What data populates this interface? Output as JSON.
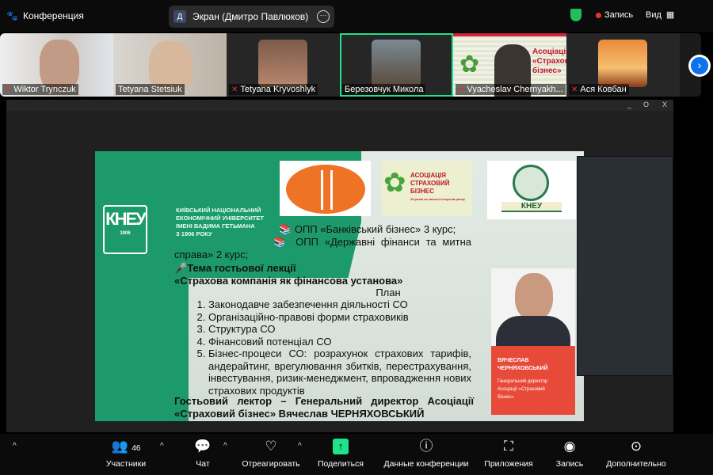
{
  "topbar": {
    "title": "Конференция",
    "screen_badge": "Д",
    "screen_label": "Экран (Дмитро Павлюков)",
    "record_label": "Запись",
    "view_label": "Вид"
  },
  "participants": [
    {
      "name": "Wiktor Trynczuk",
      "muted": true
    },
    {
      "name": "Tetyana Stetsiuk",
      "muted": false
    },
    {
      "name": "Tetyana Kryvoshlyk",
      "muted": true
    },
    {
      "name": "Березовчук Микола",
      "muted": false,
      "active": true
    },
    {
      "name": "Vyacheslav Chernyakh...",
      "muted": true
    },
    {
      "name": "Ася Ковбан",
      "muted": true
    }
  ],
  "tile_slogan": "Асоціація «Страховий бізнес»",
  "window_controls": {
    "min": "_",
    "max": "O",
    "close": "X"
  },
  "slide": {
    "university": [
      "КИЇВСЬКИЙ НАЦІОНАЛЬНИЙ",
      "ЕКОНОМІЧНИЙ УНІВЕРСИТЕТ",
      "ІМЕНІ ВАДИМА ГЕТЬМАНА",
      "З 1906 РОКУ"
    ],
    "kneu_logo": "КНЕУ",
    "kneu_year": "1906",
    "assoc_logo": [
      "АСОЦІАЦІЯ",
      "СТРАХОВИЙ БІЗНЕС",
      "20 років на захисті інтересів ринку"
    ],
    "kneu_emblem": "КНЕУ",
    "program1": "ОПП «Банківський бізнес» 3 курс;",
    "program2": "ОПП «Державні фінанси та митна справа» 2 курс;",
    "topic_label": "Тема гостьової лекції",
    "topic": "«Страхова компанія як фінансова установа»",
    "plan_title": "План",
    "plan": [
      "Законодавче забезпечення діяльності СО",
      "Організаційно-правові форми страховиків",
      "Структура СО",
      "Фінансовий потенціал СО",
      "Бізнес-процеси СО: розрахунок страхових тарифів, андерайтинг, врегулювання збитків, перестрахування, інвестування, ризик-менеджмент, впровадження нових страхових продуктів"
    ],
    "lecturer": "Гостьовий лектор – Генеральний директор Асоціації «Страховий бізнес» Вячеслав ЧЕРНЯХОВСЬКИЙ",
    "speaker_name": "ВЯЧЕСЛАВ ЧЕРНЯХОВСЬКИЙ",
    "speaker_title": "Генеральний директор Асоціації «Страховий бізнес»"
  },
  "toolbar": {
    "participants_count": "46",
    "participants": "Участники",
    "chat": "Чат",
    "react": "Отреагировать",
    "share": "Поделиться",
    "info": "Данные конференции",
    "apps": "Приложения",
    "record": "Запись",
    "more": "Дополнительно"
  },
  "colors": {
    "accent": "#0e72ed",
    "share": "#1ee38a",
    "slide_green": "#1d9a6c",
    "record": "#e8332b"
  }
}
